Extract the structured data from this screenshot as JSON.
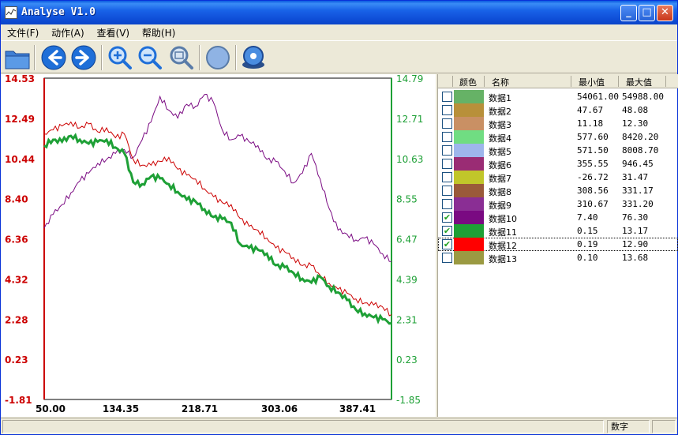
{
  "window": {
    "title": "Analyse V1.0",
    "controls": {
      "minimize": "_",
      "maximize": "□",
      "close": "✕"
    }
  },
  "menu": [
    {
      "label": "文件(F)"
    },
    {
      "label": "动作(A)"
    },
    {
      "label": "查看(V)"
    },
    {
      "label": "帮助(H)"
    }
  ],
  "toolbar": [
    {
      "name": "open-folder-icon",
      "icon": "folder"
    },
    {
      "name": "back-arrow-icon",
      "icon": "arrow-left"
    },
    {
      "name": "forward-arrow-icon",
      "icon": "arrow-right"
    },
    {
      "name": "zoom-in-icon",
      "icon": "zoom-in"
    },
    {
      "name": "zoom-out-icon",
      "icon": "zoom-out"
    },
    {
      "name": "zoom-fit-icon",
      "icon": "zoom-fit"
    },
    {
      "name": "circle-icon",
      "icon": "circle"
    },
    {
      "name": "settings-disk-icon",
      "icon": "disk"
    }
  ],
  "grid": {
    "headers": {
      "color": "颜色",
      "name": "名称",
      "min": "最小值",
      "max": "最大值"
    },
    "rows": [
      {
        "name": "数据1",
        "color": "#66b266",
        "min": "54061.00",
        "max": "54988.00",
        "checked": false
      },
      {
        "name": "数据2",
        "color": "#b8903a",
        "min": "47.67",
        "max": "48.08",
        "checked": false
      },
      {
        "name": "数据3",
        "color": "#c99064",
        "min": "11.18",
        "max": "12.30",
        "checked": false
      },
      {
        "name": "数据4",
        "color": "#70dd82",
        "min": "577.60",
        "max": "8420.20",
        "checked": false
      },
      {
        "name": "数据5",
        "color": "#9eb6ec",
        "min": "571.50",
        "max": "8008.70",
        "checked": false
      },
      {
        "name": "数据6",
        "color": "#9a2c74",
        "min": "355.55",
        "max": "946.45",
        "checked": false
      },
      {
        "name": "数据7",
        "color": "#c1c62a",
        "min": "-26.72",
        "max": "31.47",
        "checked": false
      },
      {
        "name": "数据8",
        "color": "#9a5a3a",
        "min": "308.56",
        "max": "331.17",
        "checked": false
      },
      {
        "name": "数据9",
        "color": "#8a2e94",
        "min": "310.67",
        "max": "331.20",
        "checked": false
      },
      {
        "name": "数据10",
        "color": "#7a0a82",
        "min": "7.40",
        "max": "76.30",
        "checked": true
      },
      {
        "name": "数据11",
        "color": "#1ea036",
        "min": "0.15",
        "max": "13.17",
        "checked": true
      },
      {
        "name": "数据12",
        "color": "#ff0000",
        "min": "0.19",
        "max": "12.90",
        "checked": true,
        "selected": true
      },
      {
        "name": "数据13",
        "color": "#9b9a42",
        "min": "0.10",
        "max": "13.68",
        "checked": false
      }
    ]
  },
  "status": {
    "cell1": "",
    "cell2": "数字"
  },
  "chart_data": {
    "type": "line",
    "x_ticks": [
      "50.00",
      "134.35",
      "218.71",
      "303.06",
      "387.41"
    ],
    "x_range": [
      50,
      440
    ],
    "left_axis": {
      "color": "#cc0000",
      "ticks": [
        "14.53",
        "12.49",
        "10.44",
        "8.40",
        "6.36",
        "4.32",
        "2.28",
        "0.23",
        "-1.81"
      ],
      "range": [
        -1.81,
        14.53
      ]
    },
    "right_axis": {
      "color": "#1ea036",
      "ticks": [
        "14.79",
        "12.71",
        "10.63",
        "8.55",
        "6.47",
        "4.39",
        "2.31",
        "0.23",
        "-1.85"
      ],
      "range": [
        -1.85,
        14.79
      ]
    },
    "series": [
      {
        "color": "#7a0a82",
        "axis": "left",
        "x": [
          50,
          60,
          70,
          80,
          90,
          100,
          110,
          120,
          130,
          140,
          150,
          160,
          170,
          180,
          190,
          200,
          210,
          220,
          230,
          240,
          250,
          260,
          270,
          280,
          290,
          300,
          310,
          320,
          330,
          340,
          350,
          360,
          370,
          380,
          390,
          400,
          410,
          420,
          430,
          440
        ],
        "y": [
          6.9,
          7.6,
          8.1,
          8.7,
          9.3,
          9.7,
          10.2,
          10.4,
          10.7,
          10.9,
          10.5,
          11.4,
          12.3,
          13.6,
          12.9,
          12.5,
          13.2,
          13.1,
          13.7,
          13.3,
          11.9,
          11.4,
          11.6,
          11.3,
          11.1,
          10.4,
          10.3,
          9.8,
          9.2,
          9.7,
          10.7,
          9.4,
          7.9,
          6.8,
          6.6,
          6.3,
          6.4,
          6.1,
          5.6,
          5.2
        ]
      },
      {
        "color": "#cc0000",
        "axis": "left",
        "x": [
          50,
          60,
          70,
          80,
          90,
          100,
          110,
          120,
          130,
          140,
          150,
          160,
          170,
          180,
          190,
          200,
          210,
          220,
          230,
          240,
          250,
          260,
          270,
          280,
          290,
          300,
          310,
          320,
          330,
          340,
          350,
          360,
          370,
          380,
          390,
          400,
          410,
          420,
          430,
          440
        ],
        "y": [
          11.7,
          11.9,
          12.1,
          12.3,
          12.0,
          12.2,
          11.8,
          12.0,
          11.5,
          11.7,
          10.4,
          10.1,
          10.1,
          10.3,
          10.5,
          9.9,
          9.6,
          9.4,
          8.9,
          8.5,
          8.2,
          8.1,
          7.4,
          7.0,
          6.8,
          6.4,
          5.9,
          5.7,
          5.4,
          5.0,
          5.0,
          4.5,
          4.1,
          3.8,
          3.6,
          3.3,
          3.1,
          3.0,
          2.9,
          2.5
        ]
      },
      {
        "color": "#1ea036",
        "axis": "right",
        "x": [
          50,
          60,
          70,
          80,
          90,
          100,
          110,
          120,
          130,
          140,
          150,
          160,
          170,
          180,
          190,
          200,
          210,
          220,
          230,
          240,
          250,
          260,
          270,
          280,
          290,
          300,
          310,
          320,
          330,
          340,
          350,
          360,
          370,
          380,
          390,
          400,
          410,
          420,
          430,
          440
        ],
        "y": [
          11.3,
          11.6,
          11.5,
          11.8,
          11.6,
          11.4,
          11.5,
          11.6,
          11.2,
          10.9,
          9.4,
          9.3,
          9.7,
          9.6,
          9.3,
          8.9,
          8.5,
          8.4,
          8.0,
          7.6,
          7.5,
          7.3,
          6.2,
          6.0,
          5.9,
          5.7,
          5.1,
          5.0,
          4.7,
          4.4,
          4.2,
          4.5,
          4.0,
          3.7,
          3.3,
          2.8,
          2.6,
          2.4,
          2.3,
          2.1
        ]
      }
    ]
  }
}
